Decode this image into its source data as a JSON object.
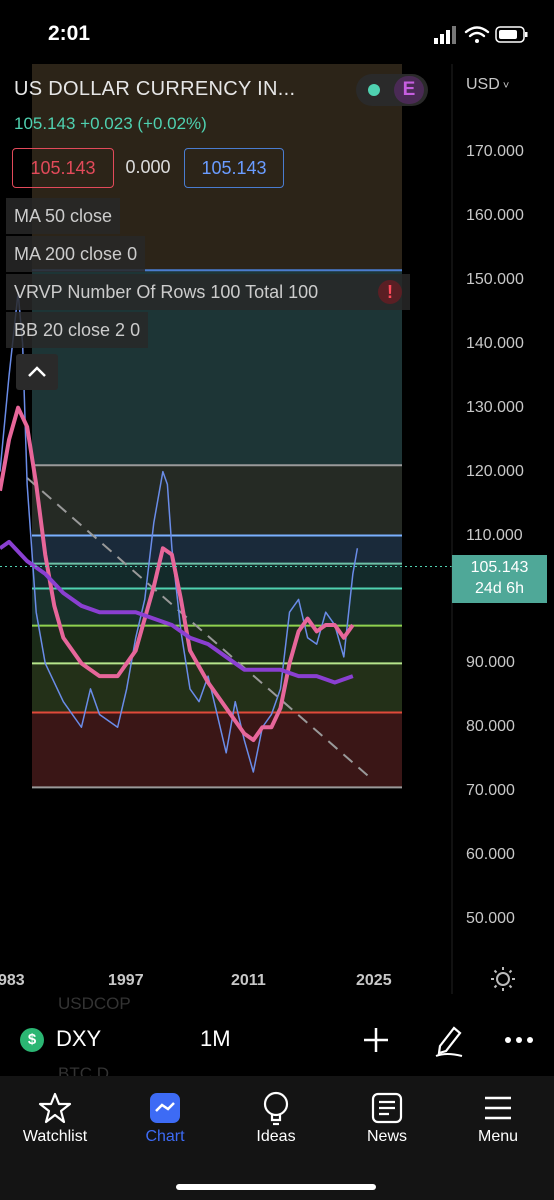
{
  "status_bar": {
    "time": "2:01"
  },
  "header": {
    "title": "US DOLLAR CURRENCY IN...",
    "price_line": "105.143 +0.023 (+0.02%)",
    "e_badge": "E",
    "bid": "105.143",
    "spread": "0.000",
    "ask": "105.143"
  },
  "indicators": [
    "MA 50 close",
    "MA 200 close 0",
    "VRVP Number Of Rows 100 Total 100",
    "BB 20 close 2 0"
  ],
  "axis": {
    "currency": "USD",
    "y_ticks": [
      "170.000",
      "160.000",
      "150.000",
      "140.000",
      "130.000",
      "120.000",
      "110.000",
      "100.000",
      "90.000",
      "80.000",
      "70.000",
      "60.000",
      "50.000"
    ],
    "x_ticks": [
      "983",
      "1997",
      "2011",
      "2025"
    ],
    "current_price": "105.143",
    "countdown": "24d 6h"
  },
  "watchlist_ghost": {
    "top": "USDCOP",
    "bottom": "BTC.D"
  },
  "toolbar": {
    "symbol": "DXY",
    "interval": "1M",
    "symbol_icon_text": "$"
  },
  "tabs": [
    {
      "label": "Watchlist",
      "icon": "star-icon",
      "active": false
    },
    {
      "label": "Chart",
      "icon": "chart-icon",
      "active": true
    },
    {
      "label": "Ideas",
      "icon": "lightbulb-icon",
      "active": false
    },
    {
      "label": "News",
      "icon": "news-icon",
      "active": false
    },
    {
      "label": "Menu",
      "icon": "menu-icon",
      "active": false
    }
  ],
  "chart_data": {
    "type": "line",
    "y_range": [
      45,
      175
    ],
    "x_range": [
      1983,
      2028
    ],
    "fib_levels": [
      {
        "value": 151.5,
        "color": "#4a7ccf"
      },
      {
        "value": 121,
        "color": "#9a9a9a"
      },
      {
        "value": 110,
        "color": "#7ab0ff"
      },
      {
        "value": 105.6,
        "color": "#6fc0a8"
      },
      {
        "value": 101.7,
        "color": "#4fd1b0"
      },
      {
        "value": 95.9,
        "color": "#8fd14f"
      },
      {
        "value": 90,
        "color": "#b7e58c"
      },
      {
        "value": 82.3,
        "color": "#e04a3a"
      },
      {
        "value": 70.6,
        "color": "#9a9a9a"
      }
    ],
    "series": [
      {
        "color": "#e7669a",
        "x": [
          1983,
          1984,
          1985,
          1986,
          1987,
          1988,
          1989,
          1990,
          1992,
          1994,
          1996,
          1998,
          2000,
          2001,
          2002,
          2003,
          2004,
          2006,
          2008,
          2009,
          2010,
          2011,
          2012,
          2013,
          2014,
          2015,
          2016,
          2017,
          2018,
          2019,
          2020,
          2021,
          2022
        ],
        "y": [
          117,
          125,
          130,
          127,
          118,
          107,
          99,
          94,
          90,
          88,
          88,
          92,
          102,
          108,
          107,
          100,
          92,
          87,
          83,
          81,
          79,
          78,
          80,
          80,
          83,
          90,
          95,
          97,
          95,
          96,
          96,
          94,
          96
        ]
      },
      {
        "color": "#8a3fd1",
        "x": [
          1983,
          1984,
          1986,
          1988,
          1990,
          1992,
          1994,
          1996,
          1998,
          2000,
          2002,
          2004,
          2006,
          2008,
          2010,
          2012,
          2014,
          2016,
          2018,
          2020,
          2022
        ],
        "y": [
          108,
          109,
          106,
          104,
          101,
          99,
          98,
          98,
          98,
          97,
          96,
          94,
          93,
          91,
          89,
          89,
          89,
          88,
          88,
          87,
          88
        ]
      },
      {
        "color": "#6a8ce8",
        "x": [
          1983,
          1984,
          1985,
          1985.5,
          1986,
          1987,
          1988,
          1990,
          1992,
          1993,
          1994,
          1996,
          1997,
          1998,
          1999,
          2000,
          2001,
          2001.5,
          2002,
          2003,
          2004,
          2005,
          2006,
          2007,
          2008,
          2009,
          2010,
          2011,
          2012,
          2013,
          2014,
          2015,
          2016,
          2017,
          2018,
          2019,
          2020,
          2021,
          2022,
          2022.5
        ],
        "y": [
          120,
          135,
          148,
          140,
          118,
          98,
          90,
          84,
          80,
          86,
          82,
          80,
          86,
          94,
          100,
          112,
          120,
          118,
          108,
          95,
          86,
          84,
          88,
          82,
          76,
          84,
          78,
          73,
          80,
          82,
          86,
          98,
          100,
          94,
          93,
          98,
          96,
          91,
          104,
          108
        ]
      }
    ]
  }
}
